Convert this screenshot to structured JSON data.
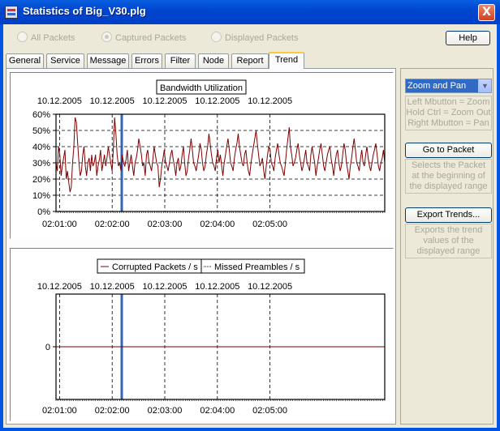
{
  "window": {
    "title": "Statistics of Big_V30.plg",
    "close_glyph": "X"
  },
  "packet_filter": {
    "options": [
      "All Packets",
      "Captured Packets",
      "Displayed Packets"
    ],
    "selected": "Captured Packets"
  },
  "help_label": "Help",
  "tabs": [
    "General",
    "Service",
    "Message",
    "Errors",
    "Filter",
    "Node",
    "Report",
    "Trend"
  ],
  "active_tab": "Trend",
  "right_panel": {
    "zoom_mode": "Zoom and Pan",
    "zoom_hint": [
      "Left Mbutton = Zoom",
      "Hold Ctrl = Zoom Out",
      "Right Mbutton = Pan"
    ],
    "goto_label": "Go to Packet",
    "goto_hint": [
      "Selects the Packet",
      "at the beginning of",
      "the displayed range"
    ],
    "export_label": "Export Trends...",
    "export_hint": [
      "Exports the trend",
      "values of the",
      "displayed range"
    ]
  },
  "chart_data": [
    {
      "type": "line",
      "title": "Bandwidth Utilization",
      "date_labels": [
        "10.12.2005",
        "10.12.2005",
        "10.12.2005",
        "10.12.2005",
        "10.12.2005"
      ],
      "time_labels": [
        "02:01:00",
        "02:02:00",
        "02:03:00",
        "02:04:00",
        "02:05:00"
      ],
      "y_ticks": [
        "0%",
        "10%",
        "20%",
        "30%",
        "40%",
        "50%",
        "60%"
      ],
      "ylim": [
        0,
        60
      ],
      "xlim_seconds": [
        0,
        375
      ],
      "marker_time": "02:02:05",
      "grid": true,
      "series": [
        {
          "color": "#800000",
          "values": [
            30,
            25,
            40,
            35,
            22,
            28,
            33,
            38,
            20,
            25,
            18,
            12,
            15,
            30,
            40,
            58,
            55,
            42,
            30,
            22,
            25,
            35,
            40,
            28,
            22,
            30,
            33,
            25,
            35,
            28,
            30,
            35,
            22,
            28,
            32,
            38,
            25,
            30,
            35,
            28,
            33,
            40,
            35,
            30,
            25,
            38,
            58,
            48,
            35,
            28,
            30,
            25,
            35,
            30,
            28,
            32,
            38,
            25,
            30,
            35,
            28,
            22,
            30,
            33,
            38,
            45,
            40,
            35,
            28,
            30,
            22,
            35,
            38,
            30,
            28,
            25,
            32,
            40,
            35,
            30,
            28,
            15,
            20,
            28,
            33,
            38,
            30,
            28,
            25,
            30,
            35,
            38,
            32,
            28,
            22,
            30,
            33,
            25,
            28,
            35,
            40,
            30,
            22,
            25,
            33,
            38,
            45,
            38,
            30,
            28,
            25,
            30,
            35,
            42,
            38,
            30,
            25,
            28,
            35,
            40,
            48,
            42,
            35,
            30,
            28,
            25,
            33,
            38,
            30,
            35,
            28,
            22,
            30,
            35,
            40,
            45,
            38,
            30,
            28,
            25,
            33,
            38,
            42,
            48,
            40,
            35,
            30,
            28,
            35,
            38,
            30,
            25,
            22,
            30,
            35,
            40,
            45,
            50,
            42,
            35,
            28,
            30,
            33,
            25,
            20,
            28,
            35,
            40,
            38,
            30,
            28,
            25,
            33,
            38,
            42,
            35,
            30,
            28,
            25,
            22,
            30,
            38,
            45,
            52,
            40,
            35,
            28,
            30,
            33,
            38,
            42,
            35,
            30,
            25,
            28,
            33,
            38,
            30,
            28,
            25,
            35,
            40,
            35,
            30,
            22,
            28,
            33,
            38,
            42,
            35,
            28,
            25,
            30,
            35,
            38,
            40,
            32,
            28,
            22,
            30,
            35,
            38,
            30,
            25,
            28,
            35,
            42,
            38,
            30,
            25,
            20,
            28,
            33,
            40,
            45,
            38,
            30,
            28,
            25,
            33,
            38,
            30,
            28,
            35,
            40,
            33,
            28,
            25,
            30,
            35,
            38,
            42,
            35,
            28,
            25,
            30,
            33,
            38,
            30
          ]
        }
      ]
    },
    {
      "type": "line",
      "date_labels": [
        "10.12.2005",
        "10.12.2005",
        "10.12.2005",
        "10.12.2005",
        "10.12.2005"
      ],
      "time_labels": [
        "02:01:00",
        "02:02:00",
        "02:03:00",
        "02:04:00",
        "02:05:00"
      ],
      "y_ticks": [
        "0"
      ],
      "xlim_seconds": [
        0,
        375
      ],
      "marker_time": "02:02:05",
      "grid": true,
      "legend": [
        "Corrupted Packets / s",
        "Missed Preambles / s"
      ],
      "series": [
        {
          "name": "Corrupted Packets / s",
          "color": "#800000",
          "value": 0
        },
        {
          "name": "Missed Preambles / s",
          "color": "#000080",
          "value": 0
        }
      ]
    }
  ]
}
